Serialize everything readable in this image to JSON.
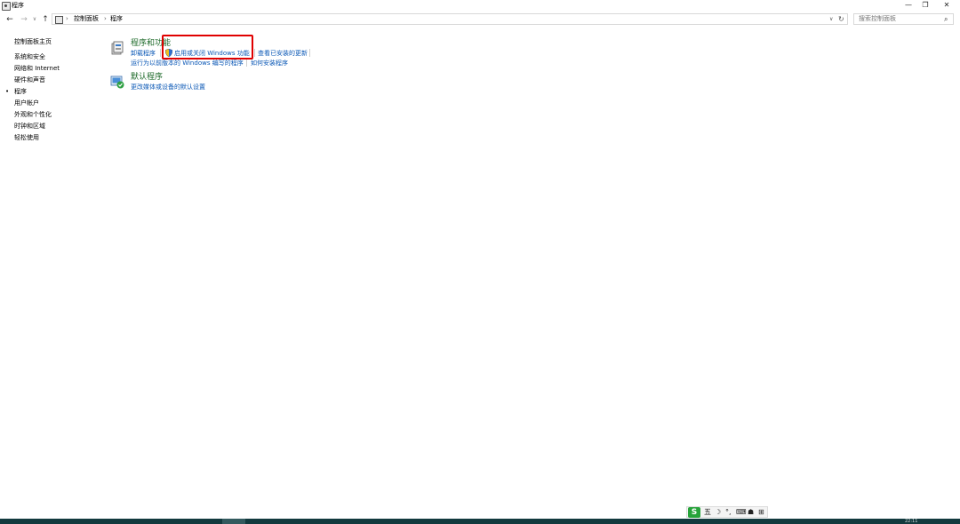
{
  "window": {
    "title": "程序",
    "icon": "control-panel-icon",
    "controls": {
      "minimize": "—",
      "maximize": "❐",
      "close": "✕"
    }
  },
  "nav": {
    "back": "←",
    "forward": "→",
    "history": "∨",
    "up": "↑",
    "breadcrumb": [
      "控制面板",
      "程序"
    ],
    "breadcrumb_separator": "›",
    "dropdown": "∨",
    "refresh": "↻",
    "search_placeholder": "搜索控制面板",
    "search_icon": "⌕"
  },
  "sidebar": {
    "items": [
      {
        "label": "控制面板主页",
        "current": false
      },
      {
        "label": "系统和安全",
        "current": false
      },
      {
        "label": "网络和 Internet",
        "current": false
      },
      {
        "label": "硬件和声音",
        "current": false
      },
      {
        "label": "程序",
        "current": true
      },
      {
        "label": "用户帐户",
        "current": false
      },
      {
        "label": "外观和个性化",
        "current": false
      },
      {
        "label": "时钟和区域",
        "current": false
      },
      {
        "label": "轻松使用",
        "current": false
      }
    ],
    "current_marker": "•"
  },
  "categories": [
    {
      "title": "程序和功能",
      "icon": "programs-features-icon",
      "links": [
        "卸载程序",
        "启用或关闭 Windows 功能",
        "查看已安装的更新",
        "运行为以前版本的 Windows 编写的程序",
        "如何安装程序"
      ]
    },
    {
      "title": "默认程序",
      "icon": "default-programs-icon",
      "links": [
        "更改媒体或设备的默认设置"
      ]
    }
  ],
  "ime_toolbar": {
    "logo": "S",
    "items": [
      "五",
      "☽",
      "°,",
      "⌨",
      "☗",
      "⊞"
    ]
  },
  "taskbar": {
    "clock": "22:11"
  },
  "colors": {
    "link": "#0b58b6",
    "category_title": "#1e6a2a",
    "highlight": "#e00000",
    "taskbar": "#123a3e"
  }
}
